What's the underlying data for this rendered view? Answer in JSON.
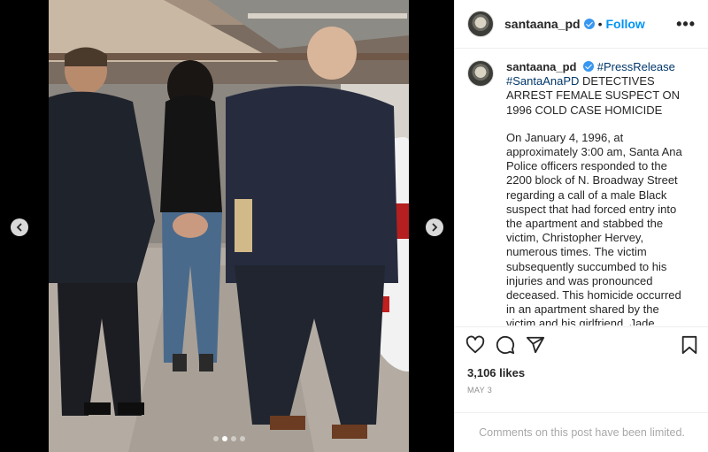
{
  "post": {
    "username": "santaana_pd",
    "follow_label": "Follow",
    "separator": "•",
    "more_label": "•••"
  },
  "caption": {
    "username": "santaana_pd",
    "hashtag_press": "#PressRelease",
    "hashtag_pd": "#SantaAnaPD",
    "headline": "DETECTIVES ARREST FEMALE SUSPECT ON 1996 COLD CASE HOMICIDE",
    "body": "On January 4, 1996, at approximately 3:00 am, Santa Ana Police officers responded to the 2200 block of N. Broadway Street regarding a call of a male Black suspect that had forced entry into the apartment and stabbed the victim, Christopher Hervey, numerous times. The victim subsequently succumbed to his injuries and was pronounced deceased.  This homicide occurred in an apartment shared by the victim and his girlfriend, Jade BENNING."
  },
  "engagement": {
    "likes": "3,106 likes",
    "date": "MAY 3",
    "comments_limited": "Comments on this post have been limited."
  },
  "carousel": {
    "current_index": 2,
    "total": 4
  },
  "icons": {
    "like": "heart-icon",
    "comment": "comment-icon",
    "share": "share-icon",
    "save": "bookmark-icon",
    "prev": "chevron-left-icon",
    "next": "chevron-right-icon"
  },
  "colors": {
    "link": "#0095f6",
    "hashtag": "#00376b",
    "verified": "#3897f0"
  }
}
